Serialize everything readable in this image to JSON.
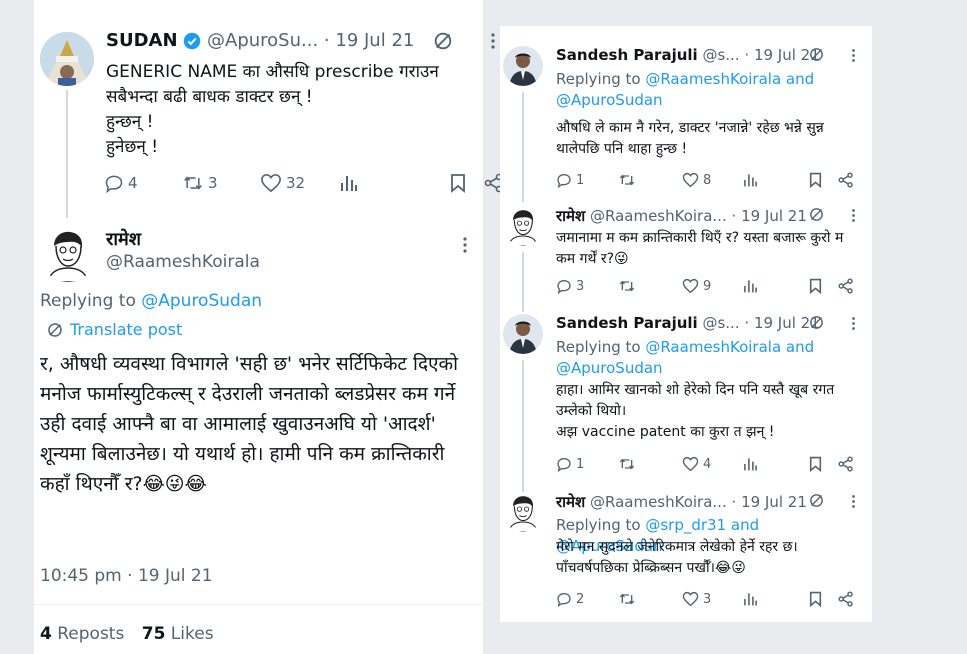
{
  "tweet1": {
    "name": "SUDAN",
    "handle": "@ApuroSu...",
    "sep": "·",
    "date": "19 Jul 21",
    "text": "GENERIC NAME का औसधि prescribe गराउन\nसबैभन्दा बढी बाधक डाक्टर छन् !\nहुन्छन् !\nहुनेछन् !",
    "actions": {
      "replies": "4",
      "reposts": "3",
      "likes": "32"
    }
  },
  "reply": {
    "name": "रामेश",
    "handle": "@RaameshKoirala",
    "replying_prefix": "Replying to ",
    "replying_to": "@ApuroSudan",
    "translate": "Translate post",
    "text": "र, औषधी व्यवस्था विभागले 'सही छ' भनेर सर्टिफिकेट दिएको मनोज फार्मास्युटिकल्स् र देउराली जनताको ब्लडप्रेसर कम गर्ने उही दवाई आफ्नै बा वा आमालाई खुवाउनअघि यो 'आदर्श' शून्यमा बिलाउनेछ। यो यथार्थ हो। हामी पनि कम क्रान्तिकारी कहाँ थिएनौँ र?😂😜😂",
    "time": "10:45 pm · 19 Jul 21",
    "reposts_count": "4",
    "reposts_label": " Reposts",
    "likes_count": "75",
    "likes_label": " Likes"
  },
  "right": [
    {
      "name": "Sandesh Parajuli",
      "handle": "@s...",
      "sep": "·",
      "date": "19 Jul 21",
      "replying_prefix": "Replying to ",
      "replying_to": "@RaameshKoirala and\n@ApuroSudan",
      "text": "औषधि ले काम नै गरेन, डाक्टर 'नजान्ने' रहेछ भन्ने सुन्न थालेपछि पनि थाहा हुन्छ !",
      "replies": "1",
      "likes": "8"
    },
    {
      "name": "रामेश",
      "handle": "@RaameshKoira...",
      "sep": "·",
      "date": "19 Jul 21",
      "text": "जमानामा म कम क्रान्तिकारी थिएँ र? यस्ता बजारू कुरो म कम गर्थें र?😜",
      "replies": "3",
      "likes": "9"
    },
    {
      "name": "Sandesh Parajuli",
      "handle": "@s...",
      "sep": "·",
      "date": "19 Jul 21",
      "replying_prefix": "Replying to ",
      "replying_to": "@RaameshKoirala and\n@ApuroSudan",
      "text": "हाहा। आमिर खानको शो हेरेको दिन पनि यस्तै खूब रगत उम्लेको थियो।\nअझ vaccine patent का कुरा त झन् !",
      "replies": "1",
      "likes": "4"
    },
    {
      "name": "रामेश",
      "handle": "@RaameshKoira...",
      "sep": "·",
      "date": "19 Jul 21",
      "replying_prefix": "Replying to ",
      "replying_to": "@srp_dr31 and @ApuroSudan",
      "text": "मेरो मन सुदनले जेनेरिकमात्र लेखेको हेर्ने रहर छ। पाँचवर्षपछिका प्रेब्क्रिब्सन पर्खौँ।😂😜",
      "replies": "2",
      "likes": "3"
    }
  ],
  "colors": {
    "accent": "#1d9bf0",
    "muted": "#536471",
    "verified": "#1d9bf0"
  }
}
